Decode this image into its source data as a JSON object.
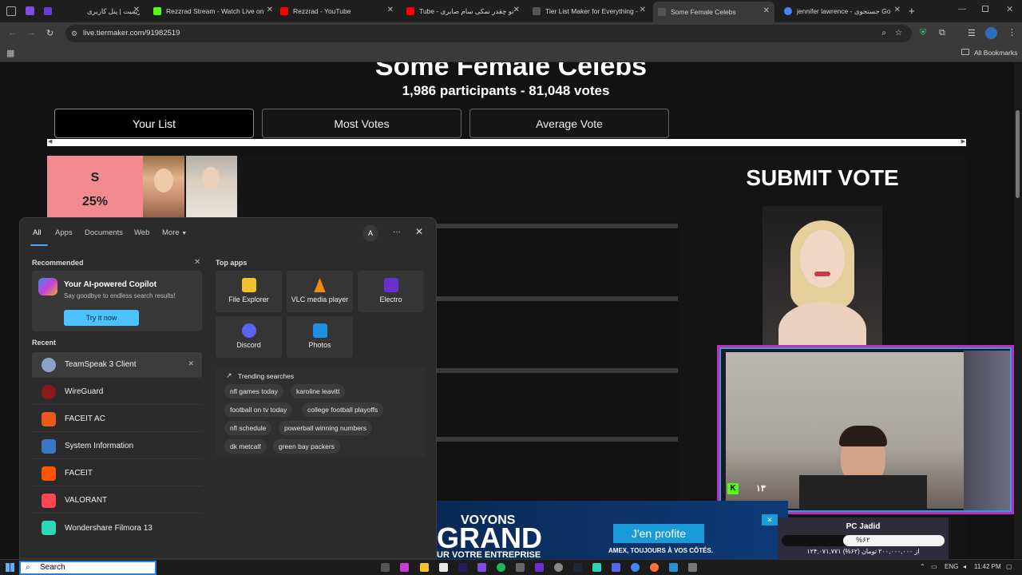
{
  "browser": {
    "tabs": [
      {
        "label": "زیمیت | پنل کاربری",
        "color": "#6a3bd8"
      },
      {
        "label": "Rezzrad Stream - Watch Live on",
        "color": "#53fc18"
      },
      {
        "label": "Rezzrad - YouTube",
        "color": "#ff0000"
      },
      {
        "label": "Tube - تو چقدر نمکی سام صابری",
        "color": "#ff0000"
      },
      {
        "label": "Tier List Maker for Everything -",
        "color": "#222222"
      },
      {
        "label": "Some Female Celebs",
        "color": "#222222"
      },
      {
        "label": "jennifer lawrence - جستجوی Go",
        "color": "#4285f4"
      }
    ],
    "url": "live.tiermaker.com/91982519",
    "bookmarks_label": "All Bookmarks"
  },
  "page": {
    "title": "Some Female Celebs",
    "participants": "1,986 participants - 81,048 votes",
    "view_tabs": [
      "Your List",
      "Most Votes",
      "Average Vote"
    ],
    "tier": {
      "label": "S",
      "percent": "25%"
    },
    "submit_title": "SUBMIT VOTE"
  },
  "flyout": {
    "nav": [
      "All",
      "Apps",
      "Documents",
      "Web",
      "More"
    ],
    "account_initial": "A",
    "more_dots": "···",
    "recommended_heading": "Recommended",
    "copilot_title": "Your AI-powered Copilot",
    "copilot_sub": "Say goodbye to endless search results!",
    "copilot_button": "Try it now",
    "recent_heading": "Recent",
    "recent": [
      {
        "label": "TeamSpeak 3 Client",
        "color": "#8aa3c8"
      },
      {
        "label": "WireGuard",
        "color": "#8b1a1a"
      },
      {
        "label": "FACEIT AC",
        "color": "#e8591b"
      },
      {
        "label": "System Information",
        "color": "#3a76c4"
      },
      {
        "label": "FACEIT",
        "color": "#ff5500"
      },
      {
        "label": "VALORANT",
        "color": "#ff4655"
      },
      {
        "label": "Wondershare Filmora 13",
        "color": "#2fd6b3"
      }
    ],
    "top_apps_heading": "Top apps",
    "top_apps": [
      {
        "label": "File Explorer",
        "color": "#f2c12e"
      },
      {
        "label": "VLC media player",
        "color": "#f08a00"
      },
      {
        "label": "Electro",
        "color": "#6b2fd0"
      },
      {
        "label": "Discord",
        "color": "#5865f2"
      },
      {
        "label": "Photos",
        "color": "#1e90e0"
      }
    ],
    "trending_heading": "Trending searches",
    "trending": [
      "nfl games today",
      "karoline leavitt",
      "football on tv today",
      "college football playoffs",
      "nfl schedule",
      "powerball winning numbers",
      "dk metcalf",
      "green bay packers"
    ]
  },
  "ad": {
    "line1": "VOYONS",
    "line2": "GRAND",
    "line3": "UR VOTRE ENTREPRISE",
    "button": "J'en profite",
    "sub": "AMEX, TOUJOURS À VOS CÔTÉS."
  },
  "widget": {
    "title": "PC Jadid",
    "progress_text": "%۶۲",
    "progress": 0.62,
    "amount": "۱۲۴,۰۷۱,۷۷۱ از ۲۰۰,۰۰۰,۰۰۰ تومان (۶۲%)"
  },
  "cam": {
    "kick_count": "۱۳"
  },
  "taskbar": {
    "search_placeholder": "Search",
    "lang": "ENG",
    "time": "11:42 PM"
  }
}
